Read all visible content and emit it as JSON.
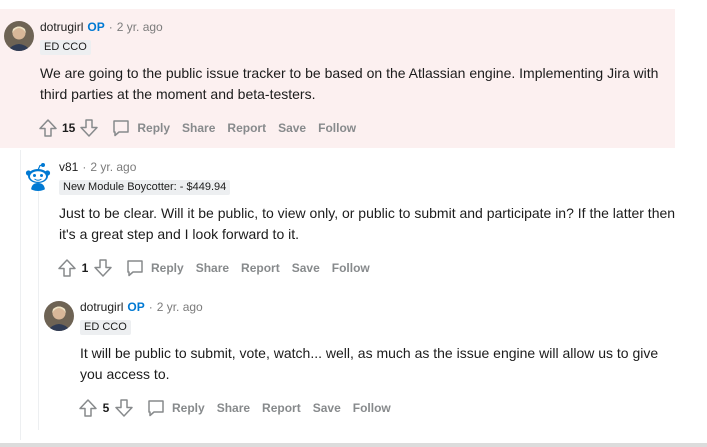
{
  "comments": [
    {
      "author": "dotrugirl",
      "op_badge": "OP",
      "separator": "·",
      "time": "2 yr. ago",
      "flair": "ED CCO",
      "text": "We are going to the public issue tracker to be based on the Atlassian engine. Implementing Jira with third parties at the moment and beta-testers.",
      "score": "15",
      "actions": [
        "Reply",
        "Share",
        "Report",
        "Save",
        "Follow"
      ]
    },
    {
      "author": "v81",
      "separator": "·",
      "time": "2 yr. ago",
      "flair": "New Module Boycotter: - $449.94",
      "text": "Just to be clear. Will it be public, to view only, or public to submit and participate in? If the latter then it's a great step and I look forward to it.",
      "score": "1",
      "actions": [
        "Reply",
        "Share",
        "Report",
        "Save",
        "Follow"
      ]
    },
    {
      "author": "dotrugirl",
      "op_badge": "OP",
      "separator": "·",
      "time": "2 yr. ago",
      "flair": "ED CCO",
      "text": "It will be public to submit, vote, watch... well, as much as the issue engine will allow us to give you access to.",
      "score": "5",
      "actions": [
        "Reply",
        "Share",
        "Report",
        "Save",
        "Follow"
      ]
    }
  ],
  "icons": {
    "upvote": "upvote-icon",
    "downvote": "downvote-icon",
    "reply": "comment-icon",
    "avatar_human": "user-avatar-photo",
    "avatar_robot": "snoo-avatar-icon"
  },
  "colors": {
    "highlight_bg": "#fcf0f0",
    "op_blue": "#0079d3",
    "muted": "#878a8c",
    "flair_bg": "#edeff1"
  }
}
